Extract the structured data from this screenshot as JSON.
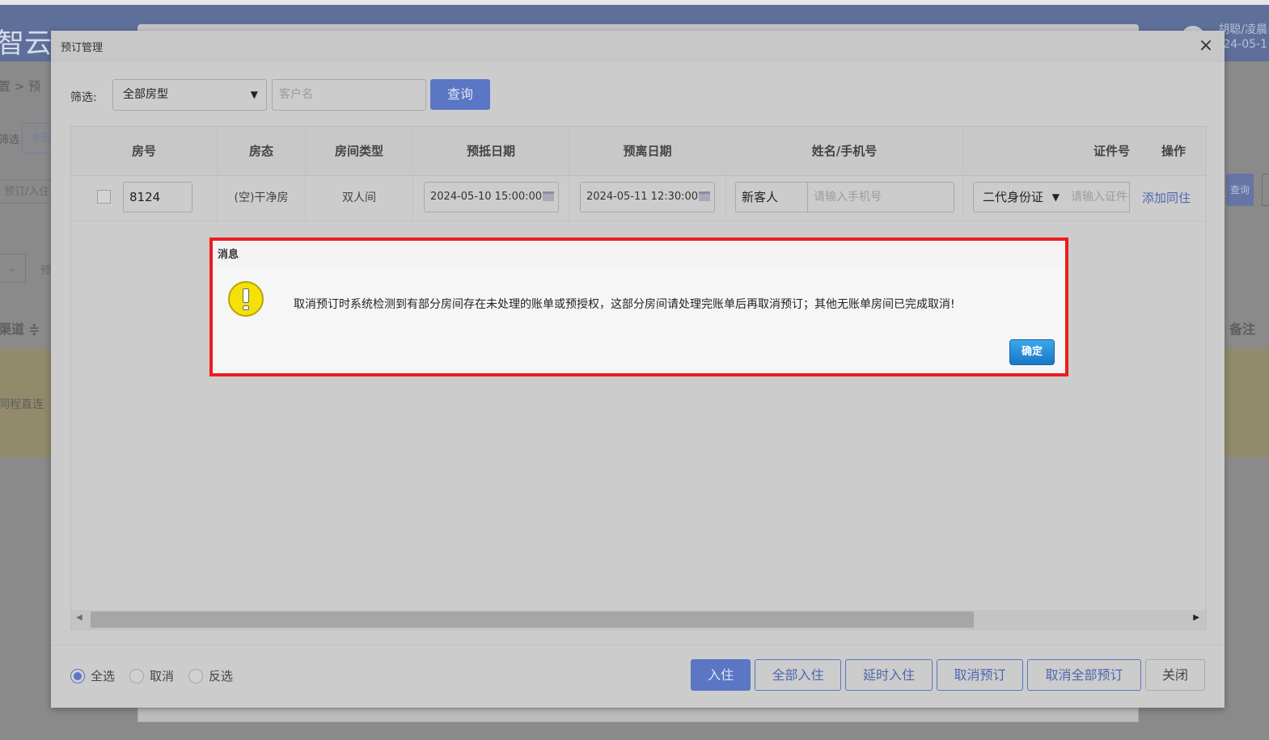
{
  "background": {
    "logo": "智云PMS",
    "user_line1": "胡聪/凌晨",
    "user_line2": "24-05-1",
    "breadcrumb": "置 > 预",
    "filter_label": "筛选",
    "today_button": "今日",
    "reservation_input": "预订/入住",
    "text_yu": "预",
    "channel_header": "渠道 ≑",
    "remark_header": "备注",
    "ctrip_label": "同程直连",
    "query_button": "查询"
  },
  "modal": {
    "title": "预订管理",
    "close_icon": "×",
    "filter_label": "筛选:",
    "room_type_select": "全部房型",
    "customer_placeholder": "客户名",
    "query_button": "查询",
    "table": {
      "headers": [
        "房号",
        "房态",
        "房间类型",
        "预抵日期",
        "预离日期",
        "姓名/手机号",
        "证件号",
        "操作"
      ],
      "row": {
        "room_no": "8124",
        "status": "(空)干净房",
        "room_type": "双人间",
        "arrival": "2024-05-10 15:00:00",
        "departure": "2024-05-11 12:30:00",
        "guest_name": "新客人",
        "phone_placeholder": "请输入手机号",
        "id_type": "二代身份证",
        "id_placeholder": "请输入证件号",
        "action": "添加同住"
      }
    },
    "radios": [
      "全选",
      "取消",
      "反选"
    ],
    "buttons": {
      "checkin": "入住",
      "checkin_all": "全部入住",
      "delay_checkin": "延时入住",
      "cancel_reservation": "取消预订",
      "cancel_all": "取消全部预订",
      "close": "关闭"
    }
  },
  "message": {
    "title": "消息",
    "text": "取消预订时系统检测到有部分房间存在未处理的账单或预授权，这部分房间请处理完账单后再取消预订；其他无账单房间已完成取消!",
    "ok_button": "确定"
  }
}
